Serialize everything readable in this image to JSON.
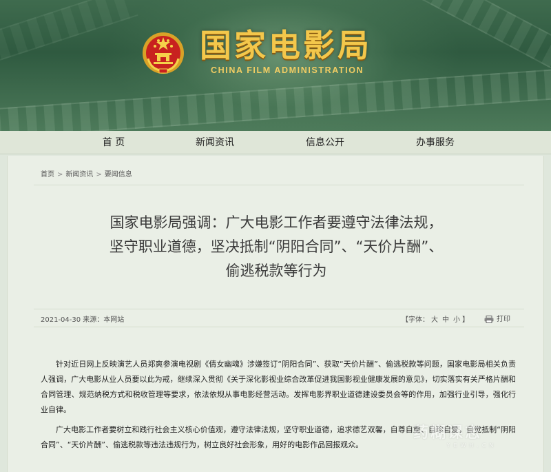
{
  "header": {
    "title_cn": "国家电影局",
    "title_en": "CHINA FILM ADMINISTRATION",
    "emblem_icon": "national-emblem-icon"
  },
  "nav": {
    "items": [
      {
        "label": "首 页"
      },
      {
        "label": "新闻资讯"
      },
      {
        "label": "信息公开"
      },
      {
        "label": "办事服务"
      }
    ]
  },
  "breadcrumb": {
    "items": [
      "首页",
      "新闻资讯",
      "要闻信息"
    ],
    "separator": ">"
  },
  "article": {
    "title_lines": [
      "国家电影局强调：广大电影工作者要遵守法律法规，",
      "坚守职业道德，坚决抵制“阴阳合同”、“天价片酬”、",
      "偷逃税款等行为"
    ],
    "meta": "2021-04-30 来源：本网站",
    "font_size": {
      "prefix": "【字体：",
      "options": [
        "大",
        "中",
        "小"
      ],
      "suffix": "】"
    },
    "print_label": "打印",
    "paragraphs": [
      "针对近日网上反映演艺人员郑爽参演电视剧《倩女幽魂》涉嫌签订“阴阳合同”、获取“天价片酬”、偷逃税款等问题，国家电影局相关负责人强调，广大电影从业人员要以此为戒，继续深入贯彻《关于深化影视业综合改革促进我国影视业健康发展的意见》，切实落实有关严格片酬和合同管理、规范纳税方式和税收管理等要求，依法依规从事电影经营活动。发挥电影界职业道德建设委员会等的作用，加强行业引导，强化行业自律。",
      "广大电影工作者要树立和践行社会主义核心价值观，遵守法律法规，坚守职业道德，追求德艺双馨，自尊自重、自珍自爱，自觉抵制“阴阳合同”、“天价片酬”、偷逃税款等违法违规行为，树立良好社会形象，用好的电影作品回报观众。"
    ]
  },
  "watermark": {
    "text_cn": "药糊课志",
    "text_en": "YEWH.CN"
  },
  "colors": {
    "banner_green": "#2f5a40",
    "logo_gold": "#f3c74b",
    "page_bg": "#dfe7dc",
    "content_bg": "#eaefe6"
  }
}
